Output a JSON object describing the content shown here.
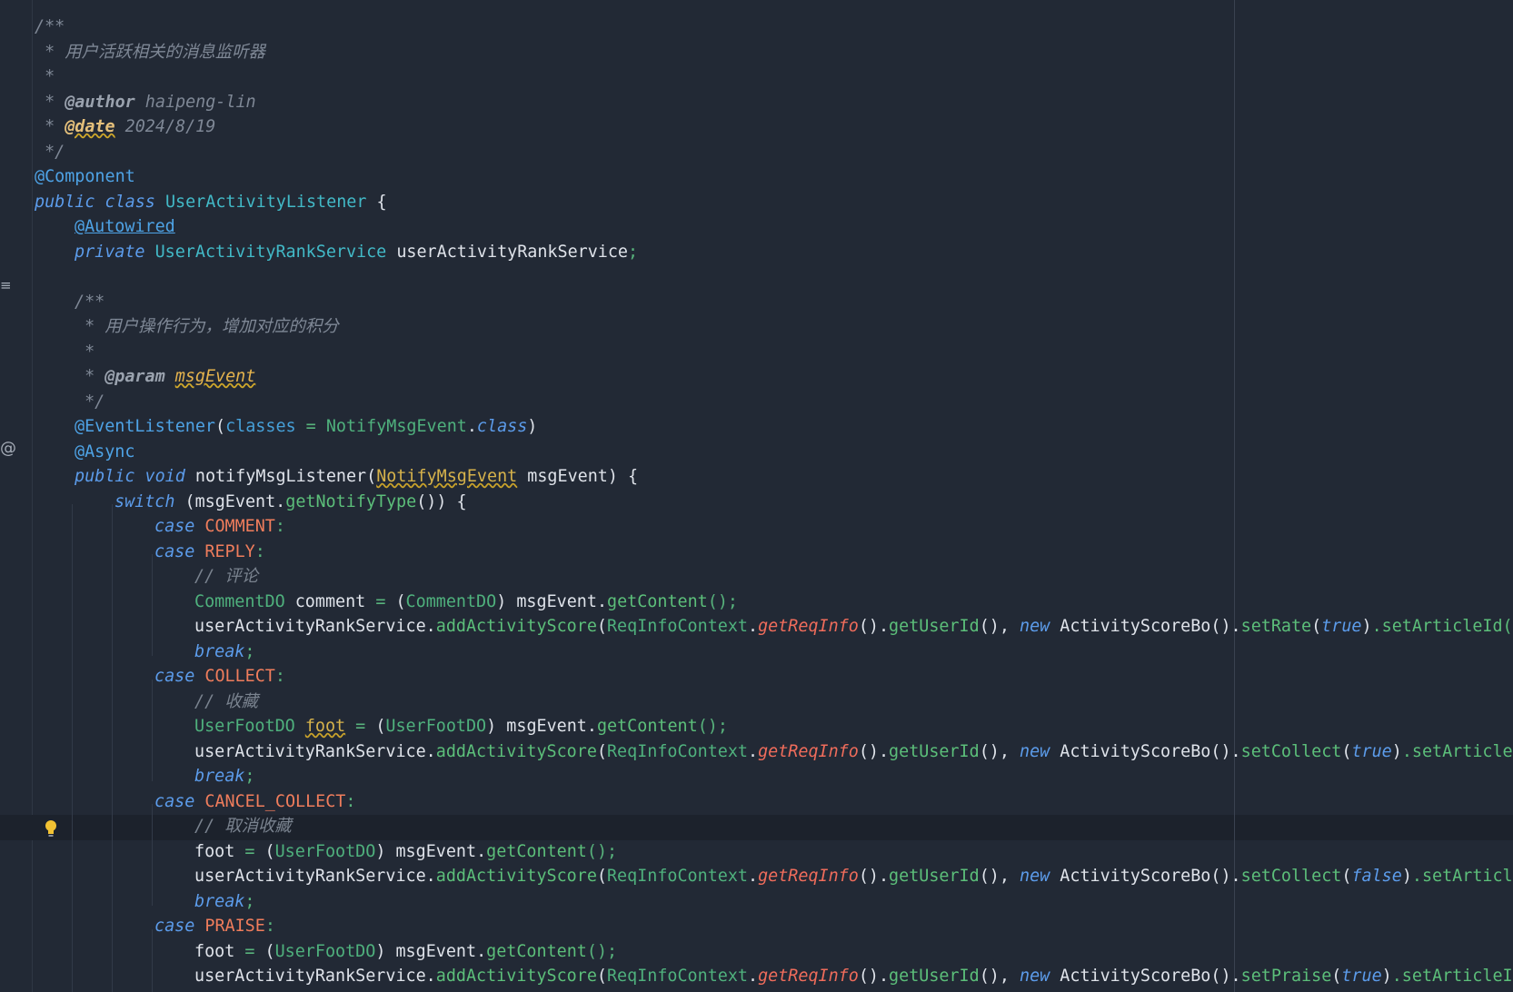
{
  "editor": {
    "language": "java",
    "colors": {
      "background": "#222935",
      "current_line": "#1c222c",
      "keyword": "#5c9ceb",
      "annotation": "#4ea3e6",
      "method": "#5cbf7a",
      "static_method": "#ef6c5b",
      "constant": "#f07d5c",
      "comment": "#7a838f",
      "warning": "#d6b24b"
    },
    "gutter": {
      "icons": [
        "doc-render-icon",
        "implementing-method-icon",
        "lightbulb-icon"
      ]
    }
  },
  "code": {
    "doc_open": "/**",
    "doc_desc": " * 用户活跃相关的消息监听器",
    "doc_blank": " *",
    "doc_author_star": " * ",
    "doc_author_tag": "@author",
    "doc_author_value": " haipeng-lin",
    "doc_date_star": " * ",
    "doc_date_tag": "@date",
    "doc_date_value": " 2024/8/19",
    "doc_close": " */",
    "ann_component": "@Component",
    "kw_public": "public",
    "kw_class": "class",
    "class_name": "UserActivityListener",
    "brace_open": " {",
    "ann_autowired": "@Autowired",
    "kw_private": "private",
    "type_rank_service": "UserActivityRankService",
    "field_rank_service": "userActivityRankService",
    "semicolon": ";",
    "m_doc_open": "/**",
    "m_doc_desc": " * 用户操作行为，增加对应的积分",
    "m_doc_blank": " *",
    "m_doc_param_star": " * ",
    "m_doc_param_tag": "@param",
    "m_doc_param_name": "msgEvent",
    "m_doc_close": " */",
    "ann_event_listener": "@EventListener",
    "paren_open": "(",
    "attr_classes": "classes",
    "eq": " = ",
    "type_notify_event": "NotifyMsgEvent",
    "dot": ".",
    "kw_class_lit": "class",
    "paren_close": ")",
    "ann_async": "@Async",
    "kw_void": "void",
    "method_name": "notifyMsgListener",
    "param_type": "NotifyMsgEvent",
    "param_name": " msgEvent",
    "sig_close": ") {",
    "kw_switch": "switch",
    "switch_open": " (",
    "var_msg_event": "msgEvent",
    "fn_get_notify_type": "getNotifyType",
    "switch_close": "()) {",
    "kw_case": "case",
    "case_comment": "COMMENT",
    "case_reply": "REPLY",
    "case_collect": "COLLECT",
    "case_cancel_collect": "CANCEL_COLLECT",
    "case_praise": "PRAISE",
    "colon": ":",
    "cmt_comment": "// 评论",
    "cmt_collect": "// 收藏",
    "cmt_cancel_collect": "// 取消收藏",
    "type_comment_do": "CommentDO",
    "var_comment": "comment",
    "type_user_foot_do": "UserFootDO",
    "var_foot": "foot",
    "cast_open": "(",
    "cast_close": ") ",
    "fn_get_content": "getContent",
    "call_end": "();",
    "var_rank_service": "userActivityRankService",
    "fn_add_activity_score": "addActivityScore",
    "cls_req_info_context": "ReqInfoContext",
    "fn_get_req_info": "getReqInfo",
    "call_empty": "()",
    "fn_get_user_id": "getUserId",
    "call_comma": "(), ",
    "kw_new": "new",
    "cls_activity_score_bo": "ActivityScoreBo",
    "fn_set_rate": "setRate",
    "fn_set_collect": "setCollect",
    "fn_set_praise": "setPraise",
    "kw_true": "true",
    "kw_false": "false",
    "tail_rate": ".setArticleId(c",
    "tail_collect": ".setArticleI",
    "tail_cancel": ".setArticle",
    "tail_praise": ".setArticleId",
    "kw_break": "break"
  }
}
